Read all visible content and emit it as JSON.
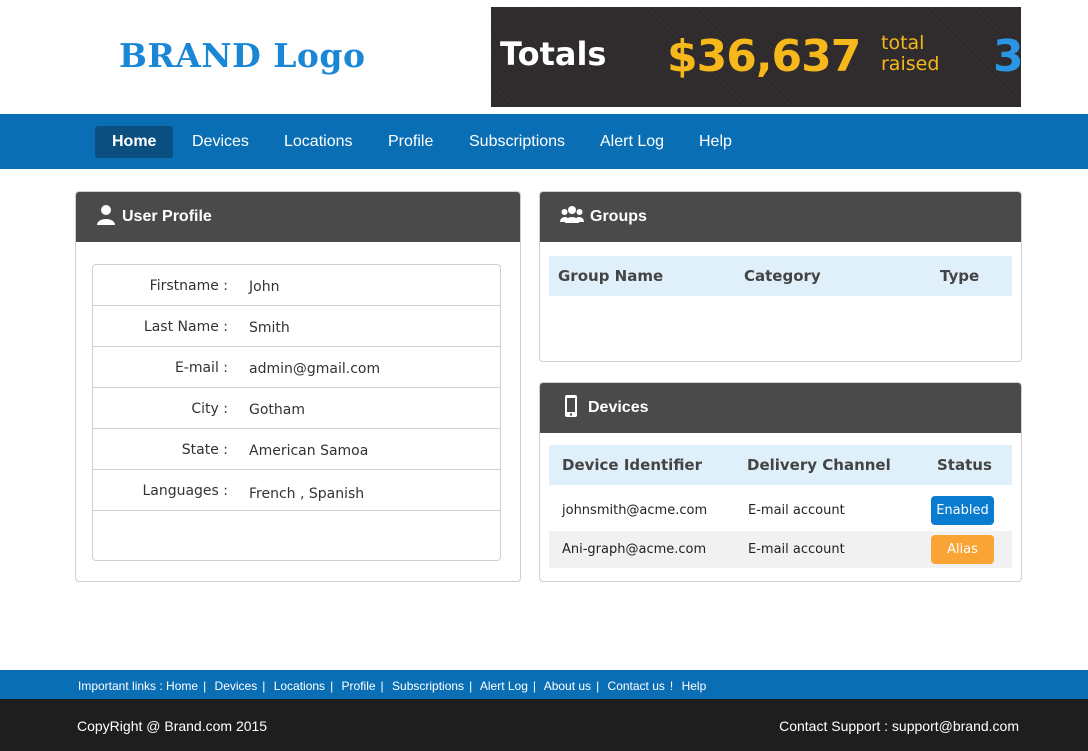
{
  "header": {
    "brand": "BRAND Logo",
    "banner": {
      "title": "Totals",
      "amount": "$36,637",
      "sub_line1": "total",
      "sub_line2": "raised",
      "extra": "3"
    }
  },
  "nav": {
    "items": [
      {
        "label": "Home",
        "active": true
      },
      {
        "label": "Devices"
      },
      {
        "label": "Locations"
      },
      {
        "label": "Profile"
      },
      {
        "label": "Subscriptions"
      },
      {
        "label": "Alert Log"
      },
      {
        "label": "Help"
      }
    ]
  },
  "profile": {
    "title": "User Profile",
    "rows": [
      {
        "label": "Firstname :",
        "value": "John"
      },
      {
        "label": "Last Name :",
        "value": "Smith"
      },
      {
        "label": "E-mail :",
        "value": "admin@gmail.com"
      },
      {
        "label": "City :",
        "value": "Gotham"
      },
      {
        "label": "State :",
        "value": "American Samoa"
      },
      {
        "label": "Languages :",
        "value": "French , Spanish"
      }
    ]
  },
  "groups": {
    "title": "Groups",
    "columns": [
      "Group Name",
      "Category",
      "Type"
    ]
  },
  "devices": {
    "title": "Devices",
    "columns": [
      "Device Identifier",
      "Delivery Channel",
      "Status"
    ],
    "rows": [
      {
        "id": "johnsmith@acme.com",
        "channel": "E-mail account",
        "status": "Enabled",
        "status_color": "#0a7cd0"
      },
      {
        "id": "Ani-graph@acme.com",
        "channel": "E-mail account",
        "status": "Alias",
        "status_color": "#f9a435"
      }
    ]
  },
  "footer": {
    "links_label": "Important links :",
    "links": [
      "Home",
      "Devices",
      "Locations",
      "Profile",
      "Subscriptions",
      "Alert Log",
      "About us",
      "Contact us",
      "Help"
    ],
    "copyright": "CopyRight @ Brand.com 2015",
    "support": "Contact Support : support@brand.com"
  },
  "colors": {
    "nav_bg": "#0a6eb4",
    "nav_active": "#0b4f80",
    "panel_head": "#4a4a4a",
    "table_head": "#dff0fb"
  }
}
